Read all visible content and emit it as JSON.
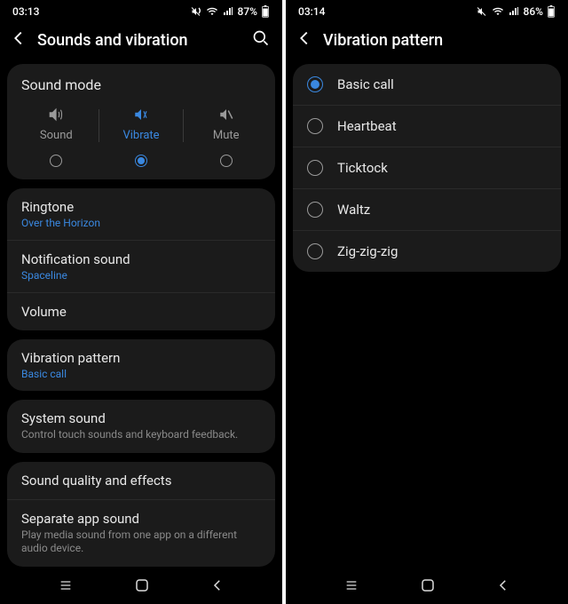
{
  "left": {
    "status": {
      "time": "03:13",
      "battery": "87%"
    },
    "header": {
      "title": "Sounds and vibration"
    },
    "sound_mode": {
      "title": "Sound mode",
      "options": [
        {
          "label": "Sound",
          "active": false
        },
        {
          "label": "Vibrate",
          "active": true
        },
        {
          "label": "Mute",
          "active": false
        }
      ]
    },
    "group1": [
      {
        "title": "Ringtone",
        "sub": "Over the Horizon",
        "subKind": "link"
      },
      {
        "title": "Notification sound",
        "sub": "Spaceline",
        "subKind": "link"
      },
      {
        "title": "Volume"
      }
    ],
    "group2": [
      {
        "title": "Vibration pattern",
        "sub": "Basic call",
        "subKind": "link"
      }
    ],
    "group3": [
      {
        "title": "System sound",
        "sub": "Control touch sounds and keyboard feedback.",
        "subKind": "desc"
      }
    ],
    "group4": [
      {
        "title": "Sound quality and effects"
      },
      {
        "title": "Separate app sound",
        "sub": "Play media sound from one app on a different audio device.",
        "subKind": "desc"
      }
    ]
  },
  "right": {
    "status": {
      "time": "03:14",
      "battery": "86%"
    },
    "header": {
      "title": "Vibration pattern"
    },
    "options": [
      {
        "label": "Basic call",
        "selected": true
      },
      {
        "label": "Heartbeat",
        "selected": false
      },
      {
        "label": "Ticktock",
        "selected": false
      },
      {
        "label": "Waltz",
        "selected": false
      },
      {
        "label": "Zig-zig-zig",
        "selected": false
      }
    ]
  }
}
